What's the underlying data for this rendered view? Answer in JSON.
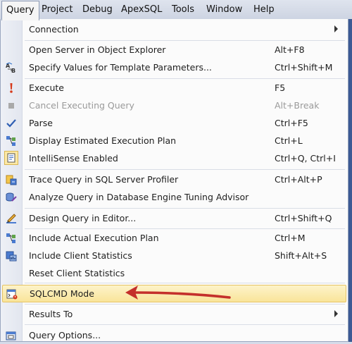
{
  "menubar": {
    "items": [
      "Query",
      "Project",
      "Debug",
      "ApexSQL",
      "Tools",
      "Window",
      "Help"
    ],
    "active": "Query"
  },
  "query_menu": {
    "items": [
      {
        "label": "Connection",
        "shortcut": "",
        "submenu": true,
        "icon": "none"
      },
      {
        "label": "Open Server in Object Explorer",
        "shortcut": "Alt+F8",
        "icon": "none"
      },
      {
        "label": "Specify Values for Template Parameters...",
        "shortcut": "Ctrl+Shift+M",
        "icon": "template-params-icon"
      },
      {
        "label": "Execute",
        "shortcut": "F5",
        "icon": "execute-icon"
      },
      {
        "label": "Cancel Executing Query",
        "shortcut": "Alt+Break",
        "icon": "cancel-icon",
        "disabled": true
      },
      {
        "label": "Parse",
        "shortcut": "Ctrl+F5",
        "icon": "checkmark-icon"
      },
      {
        "label": "Display Estimated Execution Plan",
        "shortcut": "Ctrl+L",
        "icon": "execution-plan-icon"
      },
      {
        "label": "IntelliSense Enabled",
        "shortcut": "Ctrl+Q, Ctrl+I",
        "icon": "intellisense-icon",
        "checked": true
      },
      {
        "label": "Trace Query in SQL Server Profiler",
        "shortcut": "Ctrl+Alt+P",
        "icon": "profiler-icon"
      },
      {
        "label": "Analyze Query in Database Engine Tuning Advisor",
        "shortcut": "",
        "icon": "tuning-advisor-icon"
      },
      {
        "label": "Design Query in Editor...",
        "shortcut": "Ctrl+Shift+Q",
        "icon": "design-query-icon"
      },
      {
        "label": "Include Actual Execution Plan",
        "shortcut": "Ctrl+M",
        "icon": "actual-plan-icon"
      },
      {
        "label": "Include Client Statistics",
        "shortcut": "Shift+Alt+S",
        "icon": "client-stats-icon"
      },
      {
        "label": "Reset Client Statistics",
        "shortcut": "",
        "icon": "none"
      },
      {
        "label": "SQLCMD Mode",
        "shortcut": "",
        "icon": "sqlcmd-icon",
        "highlighted": true
      },
      {
        "label": "Results To",
        "shortcut": "",
        "submenu": true,
        "icon": "none"
      },
      {
        "label": "Query Options...",
        "shortcut": "",
        "icon": "query-options-icon"
      }
    ]
  },
  "colors": {
    "highlight": "#f9e49a",
    "arrow": "#c4302b",
    "menubar": "#cdd4e2"
  }
}
